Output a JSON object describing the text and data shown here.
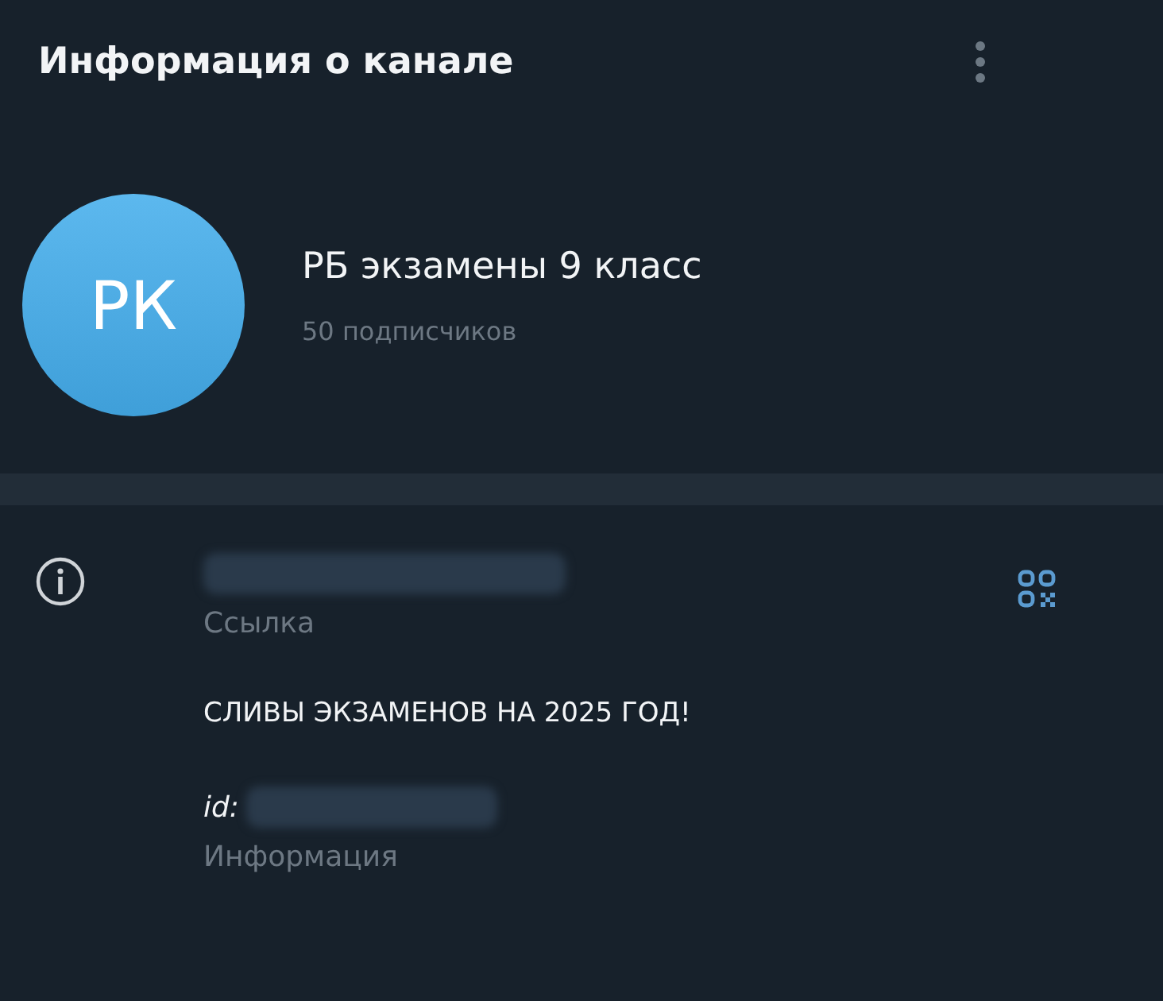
{
  "header": {
    "title": "Информация о канале"
  },
  "channel": {
    "avatar_initials": "РК",
    "name": "РБ экзамены 9 класс",
    "subscribers": "50 подписчиков"
  },
  "info": {
    "link_label": "Ссылка",
    "description": "СЛИВЫ ЭКЗАМЕНОВ НА 2025 ГОД!",
    "id_prefix": "id:",
    "description_label": "Информация"
  }
}
